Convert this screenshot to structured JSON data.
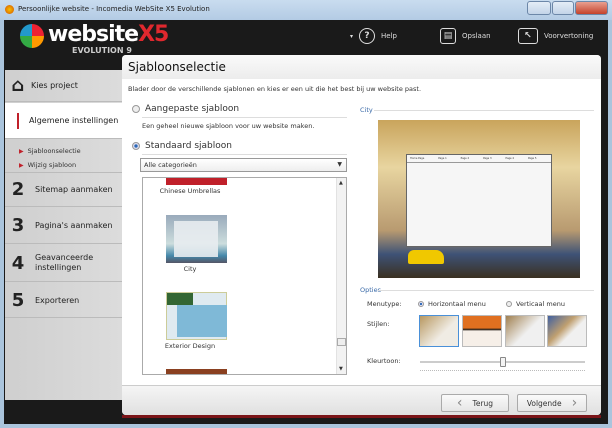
{
  "window": {
    "title": "Persoonlijke website - Incomedia WebSite X5 Evolution"
  },
  "logo": {
    "text": "website",
    "x5": "X5",
    "sub": "EVOLUTION 9"
  },
  "toolbar": {
    "help": "Help",
    "save": "Opslaan",
    "preview": "Voorvertoning"
  },
  "sidebar": {
    "items": [
      {
        "num": "",
        "label": "Kies project"
      },
      {
        "num": "",
        "label": "Algemene instellingen"
      },
      {
        "num": "2",
        "label": "Sitemap aanmaken"
      },
      {
        "num": "3",
        "label": "Pagina's aanmaken"
      },
      {
        "num": "4",
        "label": "Geavanceerde instellingen"
      },
      {
        "num": "5",
        "label": "Exporteren"
      }
    ],
    "subitems": [
      "Sjabloonselectie",
      "Wijzig sjabloon"
    ]
  },
  "main": {
    "title": "Sjabloonselectie",
    "description": "Blader door de verschillende sjablonen en kies er een uit die het best bij uw website past.",
    "custom_label": "Aangepaste sjabloon",
    "custom_desc": "Een geheel nieuwe sjabloon voor uw website maken.",
    "standard_label": "Standaard sjabloon",
    "category": "Alle categorieën",
    "templates": [
      "Chinese Umbrellas",
      "City",
      "Exterior Design"
    ],
    "preview_label": "City",
    "options_label": "Opties",
    "menutype_label": "Menutype:",
    "menu_horizontal": "Horizontaal menu",
    "menu_vertical": "Verticaal menu",
    "styles_label": "Stijlen:",
    "tone_label": "Kleurtoon:",
    "tone_value": 0.5,
    "preview_nav": [
      "Home Page",
      "Page 1",
      "Page 2",
      "Page 3",
      "Page 4",
      "Page 5"
    ]
  },
  "buttons": {
    "back": "Terug",
    "next": "Volgende"
  }
}
